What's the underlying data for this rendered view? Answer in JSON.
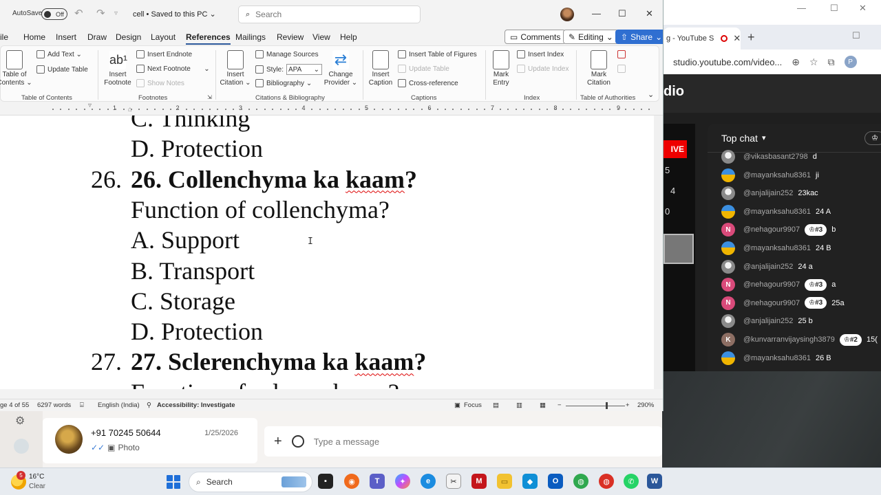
{
  "word": {
    "autosave_label": "AutoSave",
    "autosave_state": "Off",
    "doc_name": "cell • Saved to this PC",
    "search_placeholder": "Search",
    "menu": [
      "ile",
      "Home",
      "Insert",
      "Draw",
      "Design",
      "Layout",
      "References",
      "Mailings",
      "Review",
      "View",
      "Help"
    ],
    "active_menu": "References",
    "comments_label": "Comments",
    "editing_label": "Editing",
    "share_label": "Share",
    "ribbon": {
      "toc_big": "Table of Contents",
      "add_text": "Add Text",
      "update_table": "Update Table",
      "toc_group": "Table of Contents",
      "insert_footnote": "Insert Footnote",
      "insert_endnote": "Insert Endnote",
      "next_footnote": "Next Footnote",
      "show_notes": "Show Notes",
      "footnotes_group": "Footnotes",
      "insert_citation": "Insert Citation",
      "manage_sources": "Manage Sources",
      "style_label": "Style:",
      "style_value": "APA",
      "bibliography": "Bibliography",
      "change_provider": "Change Provider",
      "citations_group": "Citations & Bibliography",
      "insert_caption": "Insert Caption",
      "insert_table_of_figures": "Insert Table of Figures",
      "update_table_captions": "Update Table",
      "cross_reference": "Cross-reference",
      "captions_group": "Captions",
      "mark_entry": "Mark Entry",
      "insert_index": "Insert Index",
      "update_index": "Update Index",
      "index_group": "Index",
      "mark_citation": "Mark Citation",
      "authorities_group": "Table of Authorities"
    },
    "ruler_numbers": [
      "1",
      "2",
      "3",
      "4",
      "5",
      "6",
      "7",
      "8",
      "9"
    ],
    "document_lines": [
      {
        "text": "C. Thinking",
        "bold": false
      },
      {
        "text": "D. Protection",
        "bold": false
      },
      {
        "num": "26.",
        "text": "26. Collenchyma ka kaam?",
        "bold": true
      },
      {
        "text": "Function of collenchyma?",
        "bold": false
      },
      {
        "text": "A. Support",
        "bold": false
      },
      {
        "text": "B. Transport",
        "bold": false
      },
      {
        "text": "C. Storage",
        "bold": false
      },
      {
        "text": "D. Protection",
        "bold": false
      },
      {
        "num": "27.",
        "text": "27. Sclerenchyma ka kaam?",
        "bold": true
      },
      {
        "text": "Function of sclerenchyma?",
        "bold": false
      }
    ],
    "status": {
      "page": "ge 4 of 55",
      "words": "6297 words",
      "language": "English (India)",
      "accessibility": "Accessibility: Investigate",
      "focus": "Focus",
      "zoom": "290%"
    }
  },
  "browser": {
    "tab_title": "g - YouTube S",
    "url": "studio.youtube.com/video...",
    "profile_initial": "P",
    "studio_label": "dio",
    "live_label": "IVE",
    "stats": [
      "5",
      "4",
      "0"
    ],
    "chat_title": "Top chat",
    "chat_messages": [
      {
        "user": "@vikasbasant2798",
        "msg": "d",
        "avatar": "pic",
        "badge": ""
      },
      {
        "user": "@mayanksahu8361",
        "msg": "ji",
        "avatar": "sun",
        "badge": ""
      },
      {
        "user": "@anjalijain252",
        "msg": "23kac",
        "avatar": "pic",
        "badge": ""
      },
      {
        "user": "@mayanksahu8361",
        "msg": "24 A",
        "avatar": "sun",
        "badge": ""
      },
      {
        "user": "@nehagour9907",
        "msg": "b",
        "avatar": "N",
        "badge": "#3"
      },
      {
        "user": "@mayanksahu8361",
        "msg": "24 B",
        "avatar": "sun",
        "badge": ""
      },
      {
        "user": "@anjalijain252",
        "msg": "24 a",
        "avatar": "pic",
        "badge": ""
      },
      {
        "user": "@nehagour9907",
        "msg": "a",
        "avatar": "N",
        "badge": "#3"
      },
      {
        "user": "@nehagour9907",
        "msg": "25a",
        "avatar": "N",
        "badge": "#3"
      },
      {
        "user": "@anjalijain252",
        "msg": "25 b",
        "avatar": "pic",
        "badge": ""
      },
      {
        "user": "@kunvarranvijaysingh3879",
        "msg": "15(",
        "avatar": "K",
        "badge": "#2"
      },
      {
        "user": "@mayanksahu8361",
        "msg": "26 B",
        "avatar": "sun",
        "badge": ""
      }
    ]
  },
  "whatsapp": {
    "contact_name": "+91 70245 50644",
    "date": "1/25/2026",
    "last_message": "Photo",
    "input_placeholder": "Type a message"
  },
  "taskbar": {
    "temperature": "16°C",
    "condition": "Clear",
    "weather_badge": "5",
    "search_label": "Search"
  }
}
